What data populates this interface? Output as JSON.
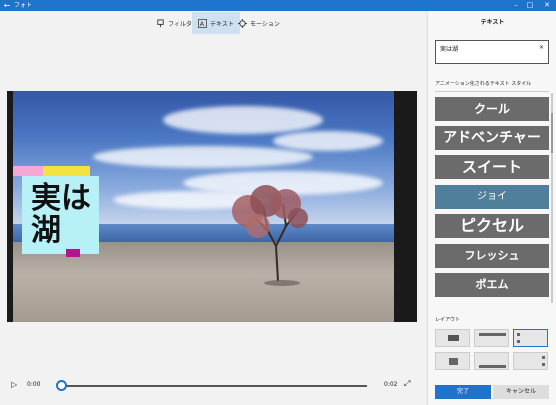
{
  "titlebar": {
    "title": "フォト",
    "back_icon": "back-arrow-icon",
    "bg": "#1e73cc"
  },
  "toolbar": {
    "items": [
      {
        "label": "フィルター",
        "icon": "filter-icon",
        "active": false
      },
      {
        "label": "テキスト",
        "icon": "text-icon",
        "active": true
      },
      {
        "label": "モーション",
        "icon": "motion-icon",
        "active": false
      }
    ]
  },
  "preview": {
    "overlay_text_line1": "実は",
    "overlay_text_line2": "湖"
  },
  "playback": {
    "current_time": "0:00",
    "duration": "0:02",
    "progress": 0.0
  },
  "panel": {
    "title": "テキスト",
    "text_input_value": "実は湖",
    "clear_icon": "close-icon",
    "styles_label": "アニメーション化されるテキスト スタイル",
    "styles": [
      {
        "label": "クール",
        "selected": false
      },
      {
        "label": "アドベンチャー",
        "selected": false
      },
      {
        "label": "スイート",
        "selected": false
      },
      {
        "label": "ジョイ",
        "selected": true
      },
      {
        "label": "ピクセル",
        "selected": false
      },
      {
        "label": "フレッシュ",
        "selected": false
      },
      {
        "label": "ポエム",
        "selected": false
      }
    ],
    "layout_label": "レイアウト",
    "done_label": "完了",
    "cancel_label": "キャンセル"
  },
  "colors": {
    "accent": "#1e73cc",
    "style_tile": "#6b6b6b",
    "style_tile_selected": "#4f7f9a"
  }
}
